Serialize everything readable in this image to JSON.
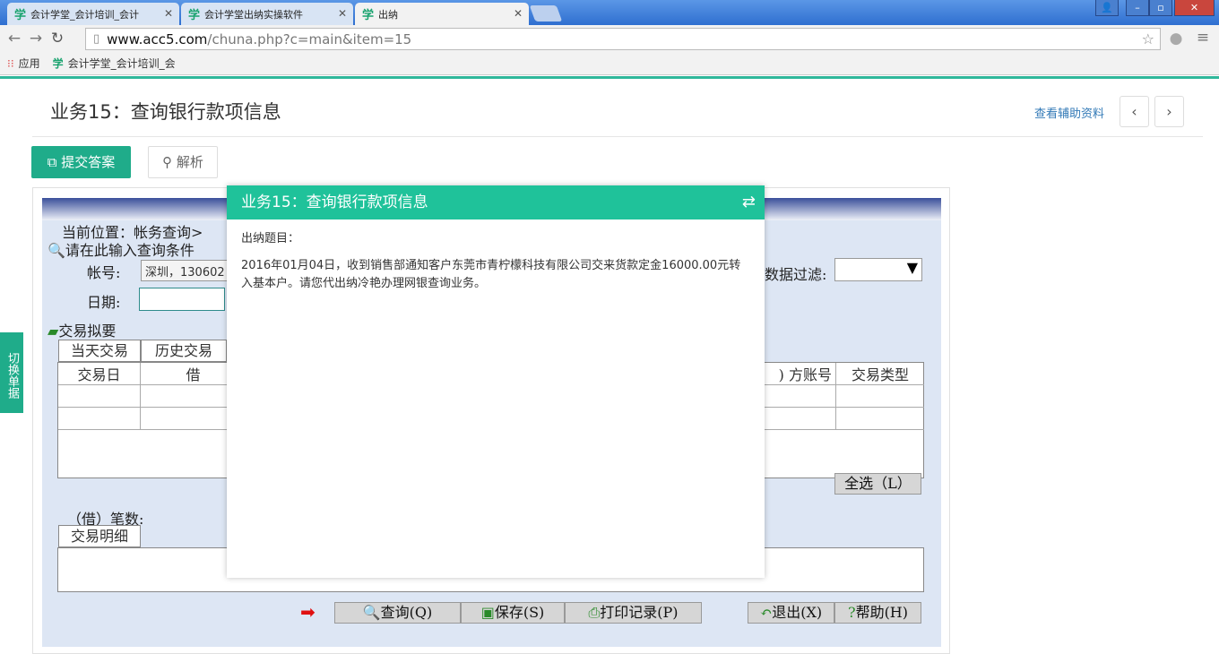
{
  "browser": {
    "tabs": [
      {
        "logo": "学",
        "label": "会计学堂_会计培训_会计"
      },
      {
        "logo": "学",
        "label": "会计学堂出纳实操软件"
      },
      {
        "logo": "学",
        "label": "出纳"
      }
    ],
    "url_host": "www.acc5.com",
    "url_path": "/chuna.php?c=main&item=15",
    "bookmarks": [
      {
        "label": "应用"
      },
      {
        "logo": "学",
        "label": "会计学堂_会计培训_会"
      }
    ]
  },
  "header": {
    "title": "业务15：查询银行款项信息",
    "help_link": "查看辅助资料"
  },
  "actions": {
    "submit": "提交答案",
    "analyze": "解析",
    "switch_doc": "切换单据"
  },
  "app": {
    "location": "当前位置：帐务查询>",
    "query_hint": "请在此输入查询条件",
    "account_label": "帐号:",
    "account_value": "深圳，130602",
    "date_label": "日期:",
    "filter_label": "数据过滤:",
    "summary_label": "交易拟要",
    "tabs": [
      "当天交易",
      "历史交易"
    ],
    "columns": [
      "交易日",
      "借",
      ")",
      "方账号",
      "交易类型"
    ],
    "select_all": "全选（L）",
    "debit_count": "（借）笔数:",
    "detail_tab": "交易明细",
    "buttons": {
      "query": "查询(Q)",
      "save": "保存(S)",
      "print": "打印记录(P)",
      "exit": "退出(X)",
      "help": "帮助(H)"
    }
  },
  "modal": {
    "title": "业务15：查询银行款项信息",
    "subtitle": "出纳题目：",
    "body": "2016年01月04日，收到销售部通知客户东莞市青柠檬科技有限公司交来货款定金16000.00元转入基本户。请您代出纳冷艳办理网银查询业务。"
  },
  "colors": {
    "accent": "#1fac8a",
    "modal_header": "#1fc29a",
    "link": "#337ab7"
  }
}
